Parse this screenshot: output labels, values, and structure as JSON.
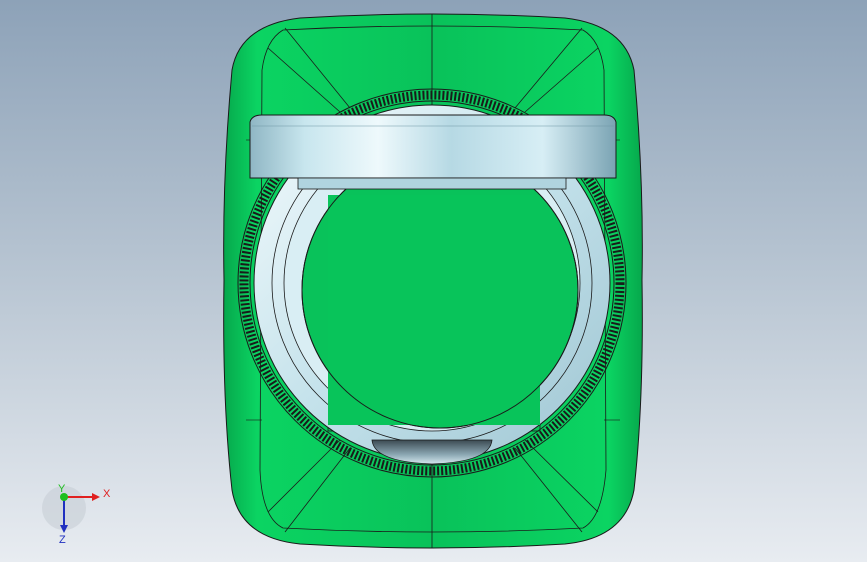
{
  "viewport": {
    "background_top": "#8da2b8",
    "background_bottom": "#e8ecf1"
  },
  "model": {
    "body_color": "#09c25a",
    "body_dark": "#067a38",
    "ring_color": "#cfe8f0",
    "band_color": "#b8dbe6",
    "knurl_color": "#2a2a2a"
  },
  "triad": {
    "x_label": "X",
    "y_label": "Y",
    "z_label": "Z",
    "x_color": "#e02020",
    "y_color": "#1fbf1f",
    "z_color": "#2030c0"
  }
}
